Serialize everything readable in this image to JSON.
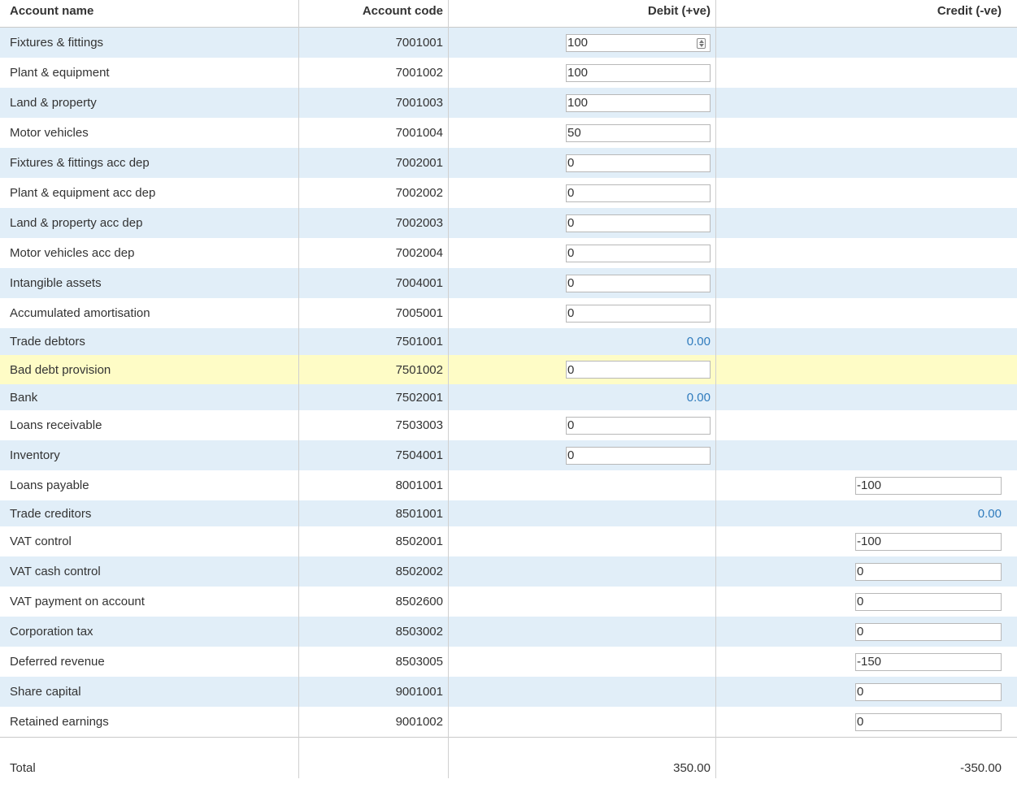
{
  "header": {
    "account_name": "Account name",
    "account_code": "Account code",
    "debit": "Debit (+ve)",
    "credit": "Credit (-ve)"
  },
  "rows": [
    {
      "name": "Fixtures & fittings",
      "code": "7001001",
      "debit_input": "100"
    },
    {
      "name": "Plant & equipment",
      "code": "7001002",
      "debit_input": "100"
    },
    {
      "name": "Land & property",
      "code": "7001003",
      "debit_input": "100"
    },
    {
      "name": "Motor vehicles",
      "code": "7001004",
      "debit_input": "50"
    },
    {
      "name": "Fixtures & fittings acc dep",
      "code": "7002001",
      "debit_input": "0"
    },
    {
      "name": "Plant & equipment acc dep",
      "code": "7002002",
      "debit_input": "0"
    },
    {
      "name": "Land & property acc dep",
      "code": "7002003",
      "debit_input": "0"
    },
    {
      "name": "Motor vehicles acc dep",
      "code": "7002004",
      "debit_input": "0"
    },
    {
      "name": "Intangible assets",
      "code": "7004001",
      "debit_input": "0"
    },
    {
      "name": "Accumulated amortisation",
      "code": "7005001",
      "debit_input": "0"
    },
    {
      "name": "Trade debtors",
      "code": "7501001",
      "debit_link": "0.00"
    },
    {
      "name": "Bad debt provision",
      "code": "7501002",
      "debit_input": "0"
    },
    {
      "name": "Bank",
      "code": "7502001",
      "debit_link": "0.00"
    },
    {
      "name": "Loans receivable",
      "code": "7503003",
      "debit_input": "0"
    },
    {
      "name": "Inventory",
      "code": "7504001",
      "debit_input": "0"
    },
    {
      "name": "Loans payable",
      "code": "8001001",
      "credit_input": "-100"
    },
    {
      "name": "Trade creditors",
      "code": "8501001",
      "credit_link": "0.00"
    },
    {
      "name": "VAT control",
      "code": "8502001",
      "credit_input": "-100"
    },
    {
      "name": "VAT cash control",
      "code": "8502002",
      "credit_input": "0"
    },
    {
      "name": "VAT payment on account",
      "code": "8502600",
      "credit_input": "0"
    },
    {
      "name": "Corporation tax",
      "code": "8503002",
      "credit_input": "0"
    },
    {
      "name": "Deferred revenue",
      "code": "8503005",
      "credit_input": "-150"
    },
    {
      "name": "Share capital",
      "code": "9001001",
      "credit_input": "0"
    },
    {
      "name": "Retained earnings",
      "code": "9001002",
      "credit_input": "0"
    }
  ],
  "total": {
    "label": "Total",
    "debit": "350.00",
    "credit": "-350.00"
  },
  "colors": {
    "row_alt": "#e1eef8",
    "row_highlight": "#fefcc6",
    "link": "#2f7bbd"
  }
}
